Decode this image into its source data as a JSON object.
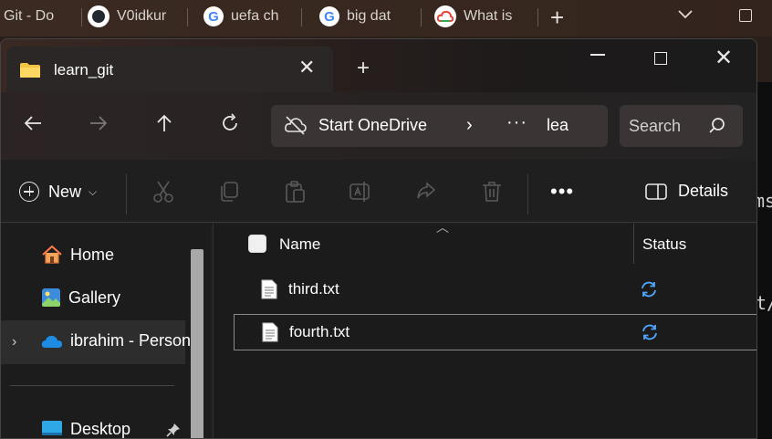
{
  "browser": {
    "tabs": [
      {
        "label": "Git - Do",
        "icon": "none"
      },
      {
        "label": "V0idkur",
        "icon": "github-icon"
      },
      {
        "label": "uefa ch",
        "icon": "google-icon"
      },
      {
        "label": "big dat",
        "icon": "google-icon"
      },
      {
        "label": "What is",
        "icon": "google-cloud-icon"
      }
    ],
    "new_tab": "+"
  },
  "explorer": {
    "tab_title": "learn_git",
    "address": {
      "root": "Start OneDrive",
      "separator": "›",
      "ellipsis": "···",
      "current": "lea"
    },
    "search_placeholder": "Search",
    "toolbar": {
      "new_label": "New",
      "details_label": "Details",
      "more": "•••"
    },
    "nav": [
      {
        "label": "Home",
        "icon": "home-icon"
      },
      {
        "label": "Gallery",
        "icon": "gallery-icon"
      },
      {
        "label": "ibrahim - Person",
        "icon": "onedrive-icon"
      },
      {
        "label": "Desktop",
        "icon": "desktop-icon"
      }
    ],
    "columns": {
      "name": "Name",
      "status": "Status"
    },
    "files": [
      {
        "name": "third.txt",
        "status": "sync-pending"
      },
      {
        "name": "fourth.txt",
        "status": "sync-pending"
      }
    ]
  },
  "background_text": [
    "ms",
    "t/"
  ],
  "colors": {
    "accent": "#4ea6ff",
    "selection": "#2d2d2d"
  }
}
